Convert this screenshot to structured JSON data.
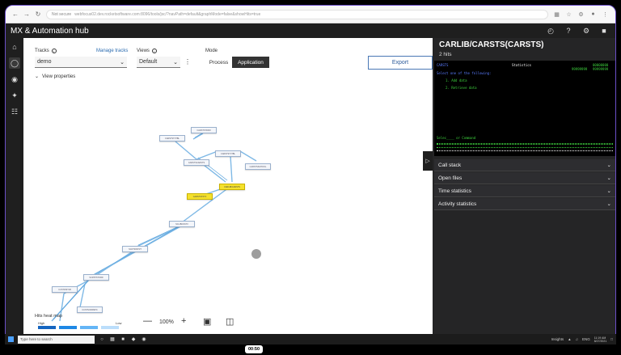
{
  "browser": {
    "security": "Not secure",
    "url": "webfocus02.dev.rocketsoftware.com:8096/tools/jsc/?navPath=default&graphMode=false&showHits=true",
    "icons": [
      "back-icon",
      "forward-icon",
      "reload-icon",
      "info-icon"
    ]
  },
  "app": {
    "title": "MX & Automation hub",
    "header_icons": [
      "history-icon",
      "help-icon",
      "settings-icon",
      "user-icon"
    ]
  },
  "rail": {
    "items": [
      "home-icon",
      "lightbulb-icon",
      "globe-icon",
      "network-icon",
      "hierarchy-icon"
    ]
  },
  "toolbar": {
    "tracks_label": "Tracks",
    "manage_tracks": "Manage tracks",
    "tracks_value": "demo",
    "views_label": "Views",
    "views_value": "Default",
    "mode_label": "Mode",
    "mode_options": [
      "Process",
      "Application"
    ],
    "mode_selected": "Application",
    "export_label": "Export"
  },
  "view_properties": "View properties",
  "graph": {
    "nodes": [
      {
        "label": "CARSTSTFRM",
        "yellow": false
      },
      {
        "label": "CARSTSTXTBL",
        "yellow": false
      },
      {
        "label": "CARSTSCARSTS",
        "yellow": false
      },
      {
        "label": "CARSTSTXTBL",
        "yellow": false
      },
      {
        "label": "CARSTSSCHOOL",
        "yellow": false
      },
      {
        "label": "CARLIB/CARSTS",
        "yellow": true
      },
      {
        "label": "CARSTSTXTX",
        "yellow": true
      },
      {
        "label": "SCLIBUNSTX",
        "yellow": false
      },
      {
        "label": "SCRTIDSTRT",
        "yellow": false
      },
      {
        "label": "SCRTPSTORD",
        "yellow": false
      },
      {
        "label": "CUSTDISTLB",
        "yellow": false
      },
      {
        "label": "CUSTNORDSPC",
        "yellow": false
      }
    ]
  },
  "heatmap": {
    "title": "Hits heat map",
    "high": "High",
    "low": "Low",
    "colors": [
      "#1565c0",
      "#1e88e5",
      "#64b5f6",
      "#bbdefb"
    ]
  },
  "zoom": {
    "minus": "—",
    "level": "100%",
    "plus": "+"
  },
  "panel": {
    "title": "CARLIB/CARSTS(CARSTS)",
    "hits": "2 hits",
    "terminal": {
      "program": "CARSTS",
      "heading": "Statistics",
      "code1": "99999999",
      "code2": "00000000",
      "code3": "99999999",
      "prompt": "Select one of the following:",
      "option1": "1. Add data",
      "option2": "2. Retrieve data",
      "command": "Selec____ or Command"
    },
    "sections": [
      "Call stack",
      "Open files",
      "Time statistics",
      "Activity statistics"
    ]
  },
  "taskbar": {
    "search_placeholder": "Type here to search",
    "tray_left": "Insights",
    "lang": "ENG",
    "time": "11:19 AM",
    "date": "8/27/2021"
  },
  "video_timer": "00:50"
}
